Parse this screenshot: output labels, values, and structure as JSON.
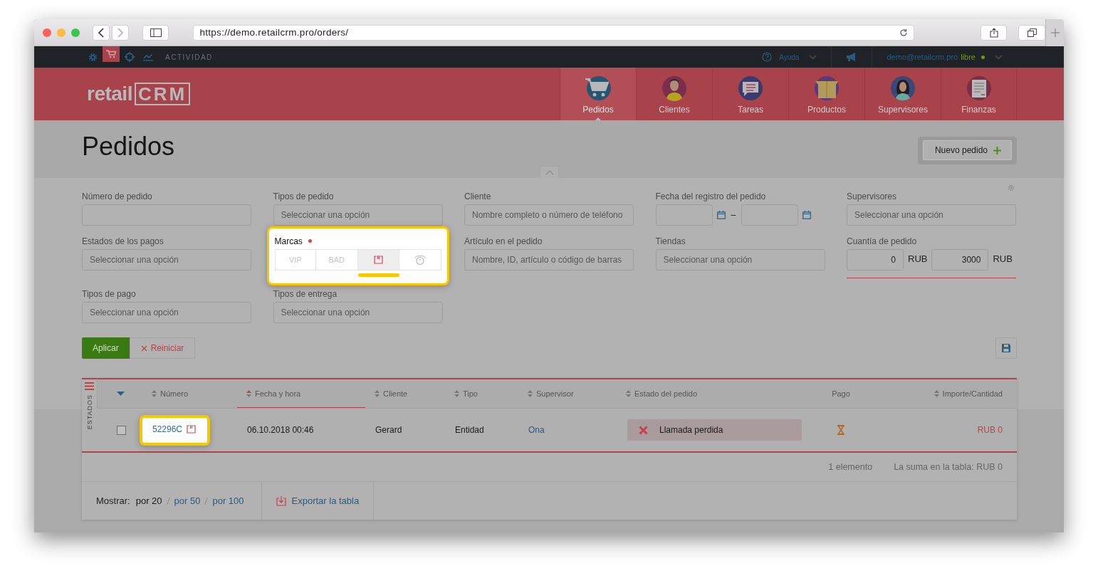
{
  "browser": {
    "url": "https://demo.retailcrm.pro/orders/"
  },
  "topbar": {
    "apps": [
      {
        "kind": "gear",
        "selected": false
      },
      {
        "kind": "cart",
        "selected": true
      },
      {
        "kind": "target",
        "selected": false
      },
      {
        "kind": "chart",
        "selected": false
      }
    ],
    "activity": "ACTIVIDAD",
    "help": "Ayuda",
    "user": "demo@retailcrm.pro",
    "plan": "libre",
    "online": true
  },
  "logo": {
    "text": "retail",
    "mark": "CRM"
  },
  "nav": [
    {
      "label": "Pedidos",
      "kind": "cart",
      "selected": true
    },
    {
      "label": "Clientes",
      "kind": "client",
      "selected": false
    },
    {
      "label": "Tareas",
      "kind": "tasks",
      "selected": false
    },
    {
      "label": "Productos",
      "kind": "box",
      "selected": false
    },
    {
      "label": "Supervisores",
      "kind": "manager",
      "selected": false
    },
    {
      "label": "Finanzas",
      "kind": "finance",
      "selected": false
    }
  ],
  "page": {
    "title": "Pedidos",
    "new_button": "Nuevo pedido"
  },
  "filter_rows": [
    [
      {
        "kind": "text",
        "label": "Número de pedido"
      },
      {
        "kind": "select",
        "label": "Tipos de pedido",
        "placeholder": "Seleccionar una opción"
      },
      {
        "kind": "text",
        "label": "Cliente",
        "placeholder": "Nombre completo o número de teléfono"
      },
      {
        "kind": "date_range",
        "label": "Fecha del registro del pedido",
        "separator": "–"
      },
      {
        "kind": "select",
        "label": "Supervisores",
        "placeholder": "Seleccionar una opción"
      }
    ],
    [
      {
        "kind": "select",
        "label": "Estados de los pagos",
        "placeholder": "Seleccionar una opción"
      },
      {
        "kind": "marks",
        "label": "Marcas",
        "highlighted": true,
        "required": true,
        "tags": [
          {
            "kind": "text",
            "label": "VIP",
            "selected": false
          },
          {
            "kind": "text",
            "label": "BAD",
            "selected": false
          },
          {
            "kind": "flag",
            "selected": true
          },
          {
            "kind": "alarm",
            "selected": false
          }
        ]
      },
      {
        "kind": "text",
        "label": "Artículo en el pedido",
        "placeholder": "Nombre, ID, artículo o código de barras"
      },
      {
        "kind": "select",
        "label": "Tiendas",
        "placeholder": "Seleccionar una opción"
      },
      {
        "kind": "amount_range",
        "label": "Cuantía de pedido",
        "from": "0",
        "to": "3000",
        "currency_from": "RUB",
        "currency_to": "RUB"
      }
    ],
    [
      {
        "kind": "select",
        "label": "Tipos de pago",
        "placeholder": "Seleccionar una opción"
      },
      {
        "kind": "select",
        "label": "Tipos de entrega",
        "placeholder": "Seleccionar una opción"
      }
    ]
  ],
  "actions": {
    "apply": "Aplicar",
    "reset": "Reiniciar"
  },
  "table": {
    "side_tab": "ESTADOS",
    "columns": [
      {
        "label": "Número",
        "sortable": true,
        "sorted": false
      },
      {
        "label": "Fecha y hora",
        "sortable": true,
        "sorted": true
      },
      {
        "label": "Cliente",
        "sortable": true,
        "sorted": false
      },
      {
        "label": "Tipo",
        "sortable": true,
        "sorted": false
      },
      {
        "label": "Supervisor",
        "sortable": true,
        "sorted": false
      },
      {
        "label": "Estado del pedido",
        "sortable": true,
        "sorted": false
      },
      {
        "label": "Pago",
        "sortable": false,
        "sorted": false
      },
      {
        "label": "Importe/Cantidad",
        "sortable": true,
        "sorted": false
      }
    ],
    "rows": [
      {
        "checked": false,
        "number": "52296C",
        "highlighted": true,
        "flagged": true,
        "date": "06.10.2018 00:46",
        "client": "Gerard",
        "type": "Entidad",
        "supervisor": "Ona",
        "status": {
          "label": "Llamada perdida",
          "kind": "cancelled"
        },
        "payment": {
          "kind": "pending"
        },
        "amount": "RUB 0"
      }
    ],
    "count": "1 elemento",
    "total": "La suma en la tabla: RUB 0"
  },
  "footer": {
    "show_label": "Mostrar:",
    "page_sizes": [
      {
        "label": "por 20",
        "selected": true
      },
      {
        "label": "por 50",
        "selected": false
      },
      {
        "label": "por 100",
        "selected": false
      }
    ],
    "export": "Exportar la tabla"
  }
}
